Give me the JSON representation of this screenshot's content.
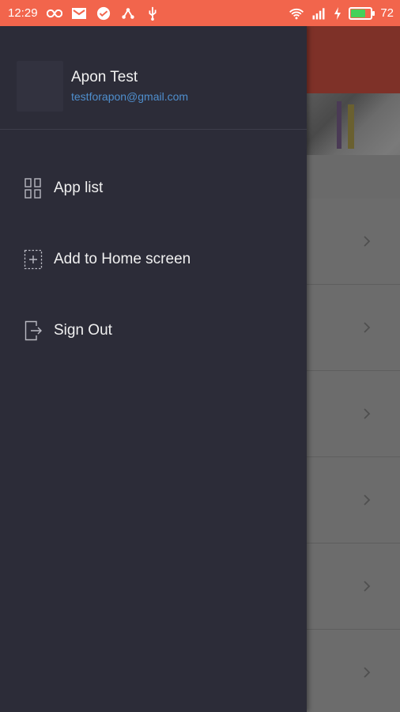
{
  "status_bar": {
    "time": "12:29",
    "battery_percent": "72",
    "battery_level": 0.72,
    "left_icons": [
      "infinity-icon",
      "gmail-icon",
      "message-icon",
      "share-icon",
      "usb-icon"
    ],
    "right_icons": [
      "wifi-icon",
      "signal-icon",
      "charging-icon",
      "battery-icon"
    ],
    "bar_color": "#f2654c"
  },
  "drawer": {
    "profile": {
      "name": "Apon Test",
      "email": "testforapon@gmail.com"
    },
    "menu": [
      {
        "label": "App list",
        "icon": "grid-icon"
      },
      {
        "label": "Add to Home screen",
        "icon": "add-box-icon"
      },
      {
        "label": "Sign Out",
        "icon": "sign-out-icon"
      }
    ],
    "background_color": "#2c2c38",
    "email_color": "#4f8fce"
  },
  "background_app": {
    "header_color": "#7e3128",
    "row_count": 6,
    "row_icon": "chevron-right-icon"
  }
}
